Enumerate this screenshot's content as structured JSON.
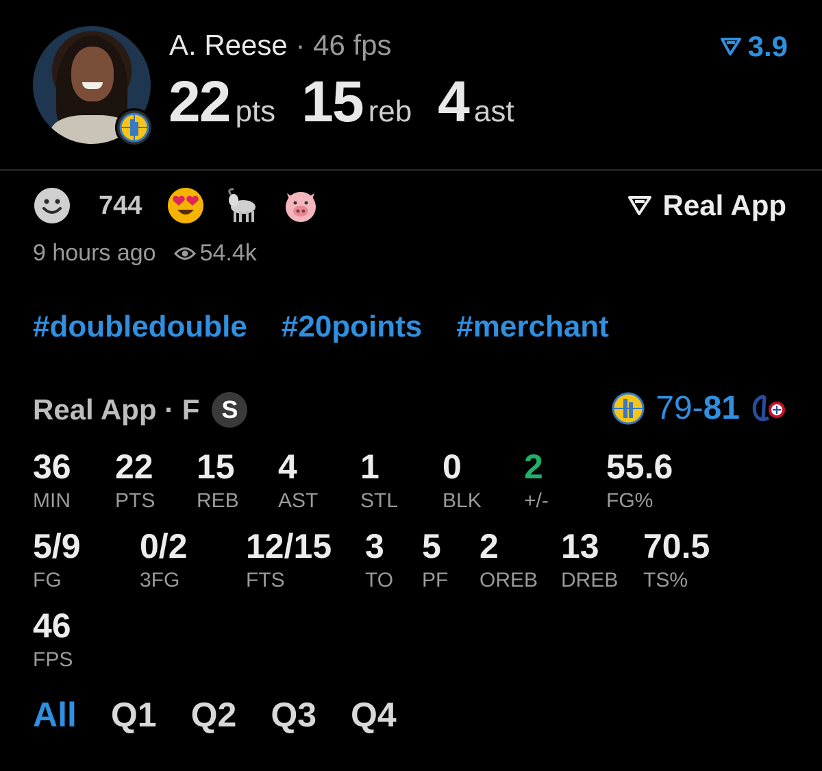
{
  "player": {
    "name": "A. Reese",
    "separator": "·",
    "fps_label": "46 fps",
    "rating": "3.9"
  },
  "headline": {
    "pts": "22",
    "pts_unit": "pts",
    "reb": "15",
    "reb_unit": "reb",
    "ast": "4",
    "ast_unit": "ast"
  },
  "reactions": {
    "count": "744",
    "icons": [
      "smiley-icon",
      "heart-eyes-emoji",
      "goat-emoji",
      "pig-emoji"
    ]
  },
  "source": "Real App",
  "meta": {
    "time_ago": "9 hours ago",
    "views": "54.4k"
  },
  "tags": [
    "#doubledouble",
    "#20points",
    "#merchant"
  ],
  "game": {
    "source_line": "Real App · F",
    "badge": "S",
    "score_left": "79",
    "score_dash": "-",
    "score_right": "81"
  },
  "stats_row1": [
    {
      "v": "36",
      "l": "MIN"
    },
    {
      "v": "22",
      "l": "PTS"
    },
    {
      "v": "15",
      "l": "REB"
    },
    {
      "v": "4",
      "l": "AST"
    },
    {
      "v": "1",
      "l": "STL"
    },
    {
      "v": "0",
      "l": "BLK"
    },
    {
      "v": "2",
      "l": "+/-"
    },
    {
      "v": "55.6",
      "l": "FG%"
    }
  ],
  "stats_row2": [
    {
      "v": "5/9",
      "l": "FG"
    },
    {
      "v": "0/2",
      "l": "3FG"
    },
    {
      "v": "12/15",
      "l": "FTS"
    },
    {
      "v": "3",
      "l": "TO"
    },
    {
      "v": "5",
      "l": "PF"
    },
    {
      "v": "2",
      "l": "OREB"
    },
    {
      "v": "13",
      "l": "DREB"
    },
    {
      "v": "70.5",
      "l": "TS%"
    }
  ],
  "stats_row3": [
    {
      "v": "46",
      "l": "FPS"
    }
  ],
  "quarters": [
    "All",
    "Q1",
    "Q2",
    "Q3",
    "Q4"
  ],
  "colors": {
    "accent": "#2f8fe0",
    "positive": "#1fb06a",
    "background": "#000000"
  }
}
